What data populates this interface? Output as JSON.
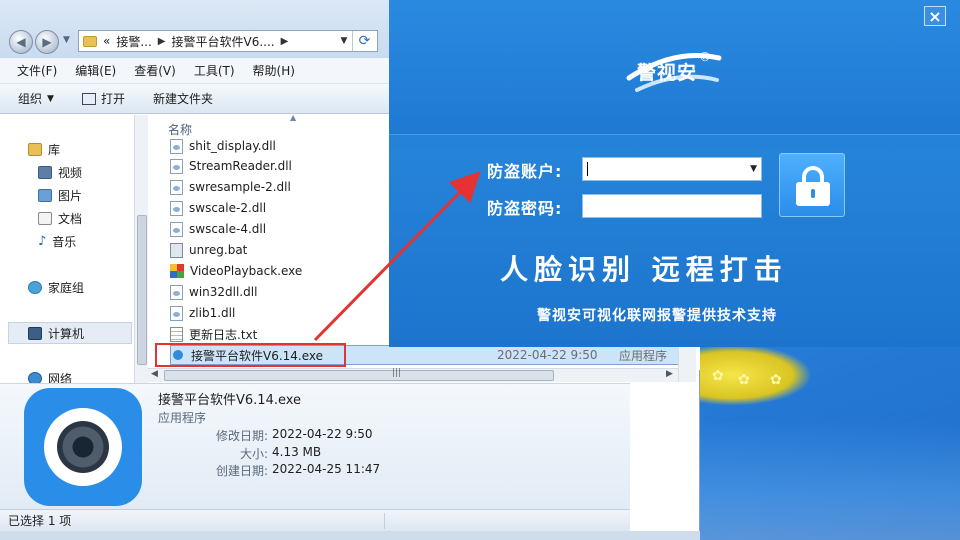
{
  "explorer": {
    "breadcrumb": {
      "overflow": "«",
      "crumb1": "接警...",
      "crumb2": "接警平台软件V6...."
    },
    "menu": [
      "文件(F)",
      "编辑(E)",
      "查看(V)",
      "工具(T)",
      "帮助(H)"
    ],
    "toolbar": {
      "organize": "组织",
      "open": "打开",
      "new_folder": "新建文件夹"
    },
    "nav": {
      "library": "库",
      "video": "视频",
      "pictures": "图片",
      "documents": "文档",
      "music": "音乐",
      "homegroup": "家庭组",
      "computer": "计算机",
      "network": "网络"
    },
    "column_name": "名称",
    "files": [
      {
        "name": "shit_display.dll",
        "icon": "dll-icon"
      },
      {
        "name": "StreamReader.dll",
        "icon": "dll-icon"
      },
      {
        "name": "swresample-2.dll",
        "icon": "dll-icon"
      },
      {
        "name": "swscale-2.dll",
        "icon": "dll-icon"
      },
      {
        "name": "swscale-4.dll",
        "icon": "dll-icon"
      },
      {
        "name": "unreg.bat",
        "icon": "bat-icon"
      },
      {
        "name": "VideoPlayback.exe",
        "icon": "exe-icon"
      },
      {
        "name": "win32dll.dll",
        "icon": "dll-icon"
      },
      {
        "name": "zlib1.dll",
        "icon": "dll-icon"
      },
      {
        "name": "更新日志.txt",
        "icon": "txt-icon"
      }
    ],
    "selected_file": {
      "name": "接警平台软件V6.14.exe",
      "date": "2022-04-22 9:50",
      "type": "应用程序"
    },
    "details": {
      "name": "接警平台软件V6.14.exe",
      "type": "应用程序",
      "modified_label": "修改日期:",
      "modified": "2022-04-22 9:50",
      "size_label": "大小:",
      "size": "4.13 MB",
      "created_label": "创建日期:",
      "created": "2022-04-25 11:47"
    },
    "status": "已选择 1 项"
  },
  "login": {
    "close": "×",
    "logo": "警视安",
    "logo_mark": "®",
    "account_label": "防盗账户:",
    "password_label": "防盗密码:",
    "account_value": "",
    "password_value": "",
    "slogan": "人脸识别  远程打击",
    "support": "警视安可视化联网报警提供技术支持"
  },
  "colors": {
    "highlight_box": "#e53232",
    "arrow": "#e53232",
    "dialog_blue": "#1f7ad2"
  }
}
